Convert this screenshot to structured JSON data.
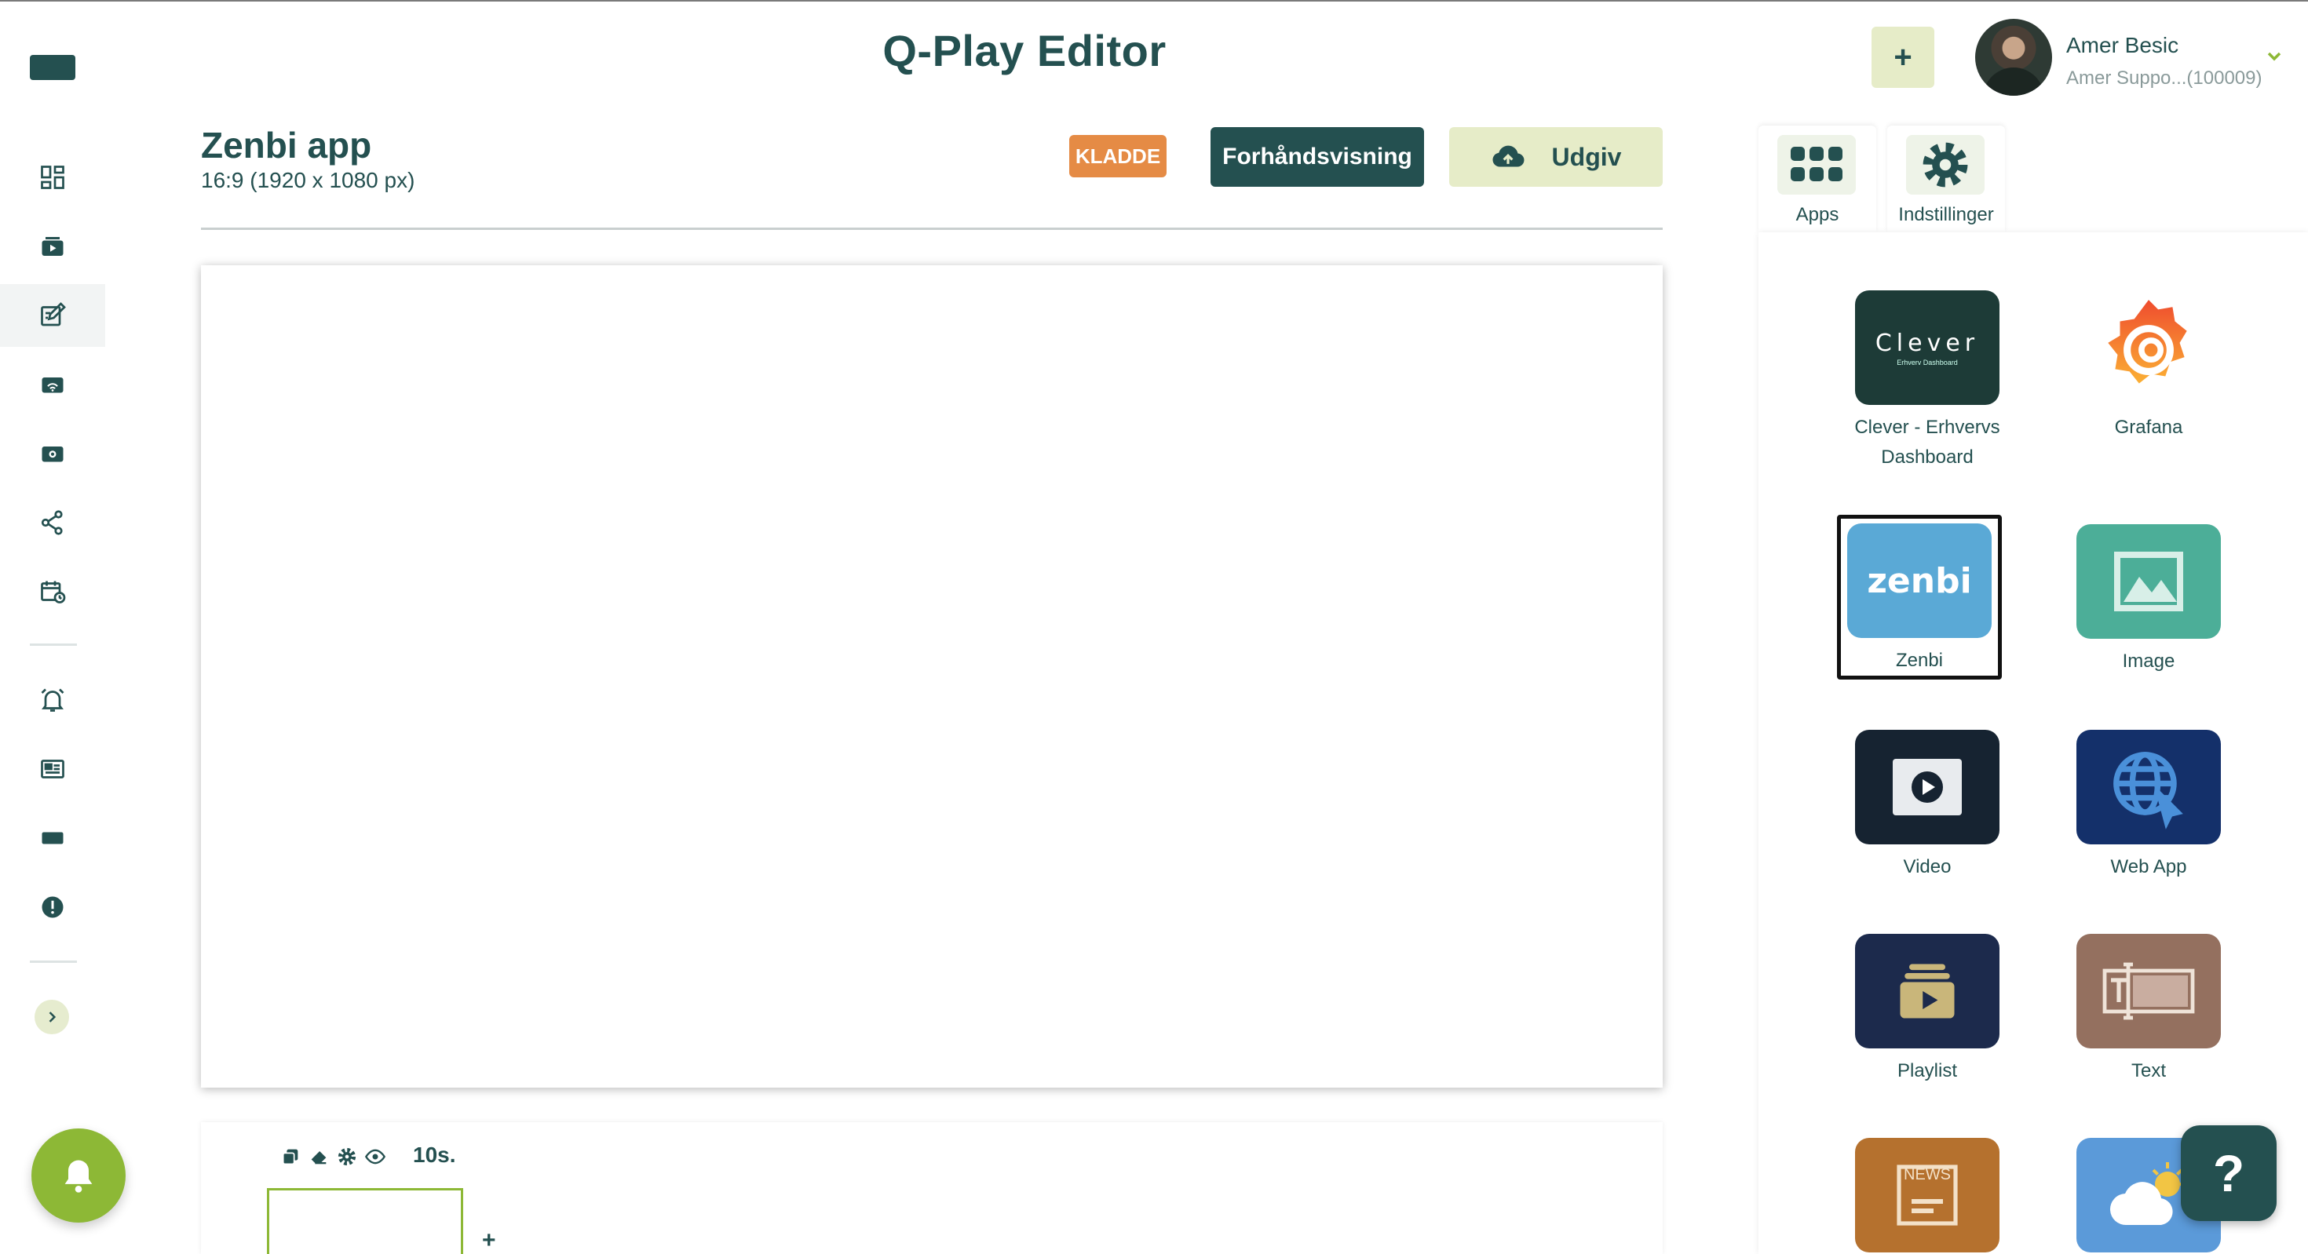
{
  "header": {
    "app_title": "Q-Play Editor",
    "add_label": "+",
    "user": {
      "name": "Amer Besic",
      "subtitle": "Amer Suppo...(100009)"
    }
  },
  "document": {
    "title": "Zenbi app",
    "resolution": "16:9 (1920 x 1080 px)",
    "status_badge": "KLADDE",
    "preview_label": "Forhåndsvisning",
    "publish_label": "Udgiv"
  },
  "sidebar": {
    "items": [
      {
        "icon": "dashboard-icon"
      },
      {
        "icon": "media-icon"
      },
      {
        "icon": "editor-icon",
        "active": true
      },
      {
        "icon": "screens-icon"
      },
      {
        "icon": "gallery-icon"
      },
      {
        "icon": "share-icon"
      },
      {
        "icon": "schedule-icon"
      },
      {
        "icon": "alarm-icon"
      },
      {
        "icon": "news-icon"
      },
      {
        "icon": "display-icon"
      },
      {
        "icon": "alert-icon"
      }
    ]
  },
  "timeline": {
    "duration": "10s.",
    "add_label": "+"
  },
  "right_panel": {
    "tabs": [
      {
        "label": "Apps",
        "icon": "apps-grid-icon"
      },
      {
        "label": "Indstillinger",
        "icon": "gear-icon"
      }
    ],
    "apps": [
      {
        "name": "Clever - Erhvervs Dashboard",
        "icon_text": "Clever",
        "icon_subtext": "Erhverv Dashboard",
        "color": "#1d3b37"
      },
      {
        "name": "Grafana",
        "icon": "grafana-logo-icon",
        "color": "#f0803c"
      },
      {
        "name": "Zenbi",
        "icon_text": "zenbi",
        "color": "#5aa9d6",
        "selected": true
      },
      {
        "name": "Image",
        "icon": "image-icon",
        "color": "#4cae98"
      },
      {
        "name": "Video",
        "icon": "video-icon",
        "color": "#162331"
      },
      {
        "name": "Web App",
        "icon": "globe-icon",
        "color": "#14306a"
      },
      {
        "name": "Playlist",
        "icon": "playlist-icon",
        "color": "#1c2a4c"
      },
      {
        "name": "Text",
        "icon": "text-icon",
        "color": "#94705f"
      },
      {
        "name": "",
        "icon": "news-icon",
        "icon_text": "NEWS",
        "color": "#b5712e"
      },
      {
        "name": "",
        "icon": "weather-icon",
        "color": "#5b9ad9"
      }
    ]
  },
  "help": {
    "label": "?"
  },
  "colors": {
    "primary": "#245050",
    "accent_green": "#8db836",
    "draft_orange": "#e58b45",
    "soft_green": "#e6ecc8"
  }
}
